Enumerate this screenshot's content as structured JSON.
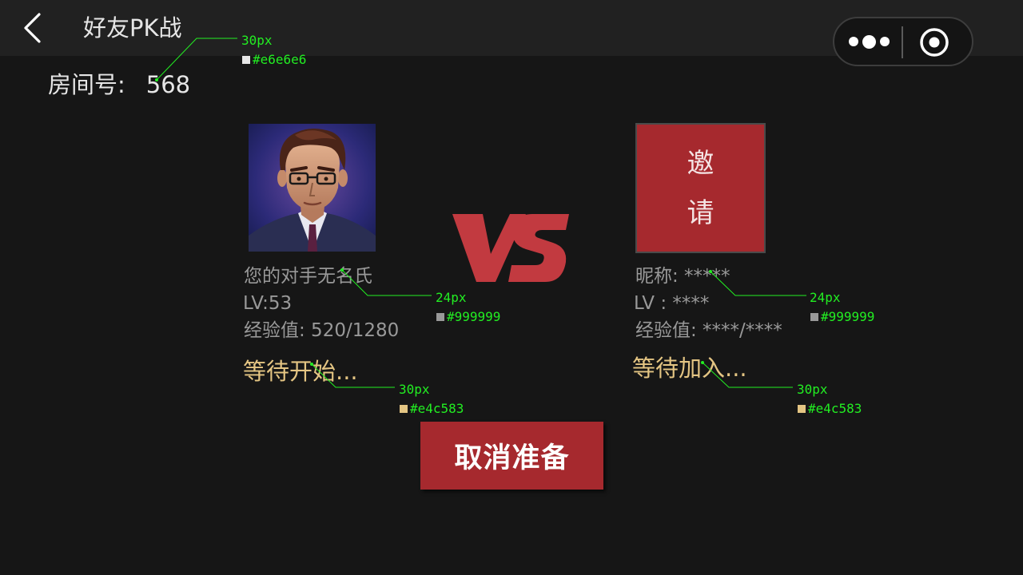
{
  "nav": {
    "title": "好友PK战"
  },
  "room": {
    "label": "房间号:",
    "number": "568"
  },
  "player": {
    "name": "您的对手无名氏",
    "level": "LV:53",
    "exp": "经验值:  520/1280",
    "status": "等待开始..."
  },
  "opponent": {
    "invite_chars": [
      "邀",
      "请"
    ],
    "nickname": "昵称: *****",
    "level": "LV :  ****",
    "exp": "经验值: ****/****",
    "status": "等待加入..."
  },
  "vs_text": "VS",
  "cancel_label": "取消准备",
  "annotations": [
    {
      "size": "30px",
      "color": "#e6e6e6"
    },
    {
      "size": "24px",
      "color": "#999999"
    },
    {
      "size": "30px",
      "color": "#e4c583"
    },
    {
      "size": "24px",
      "color": "#999999"
    },
    {
      "size": "30px",
      "color": "#e4c583"
    }
  ],
  "colors": {
    "background": "#161616",
    "topbar": "#212121",
    "accent_red": "#a6292e",
    "primary_text": "#e6e6e6",
    "secondary_text": "#999999",
    "status_text": "#e4c583",
    "annotation": "#22ee22"
  },
  "icons": [
    "back-arrow-icon",
    "more-dots-icon",
    "close-target-icon",
    "vs-logo",
    "avatar-portrait"
  ]
}
